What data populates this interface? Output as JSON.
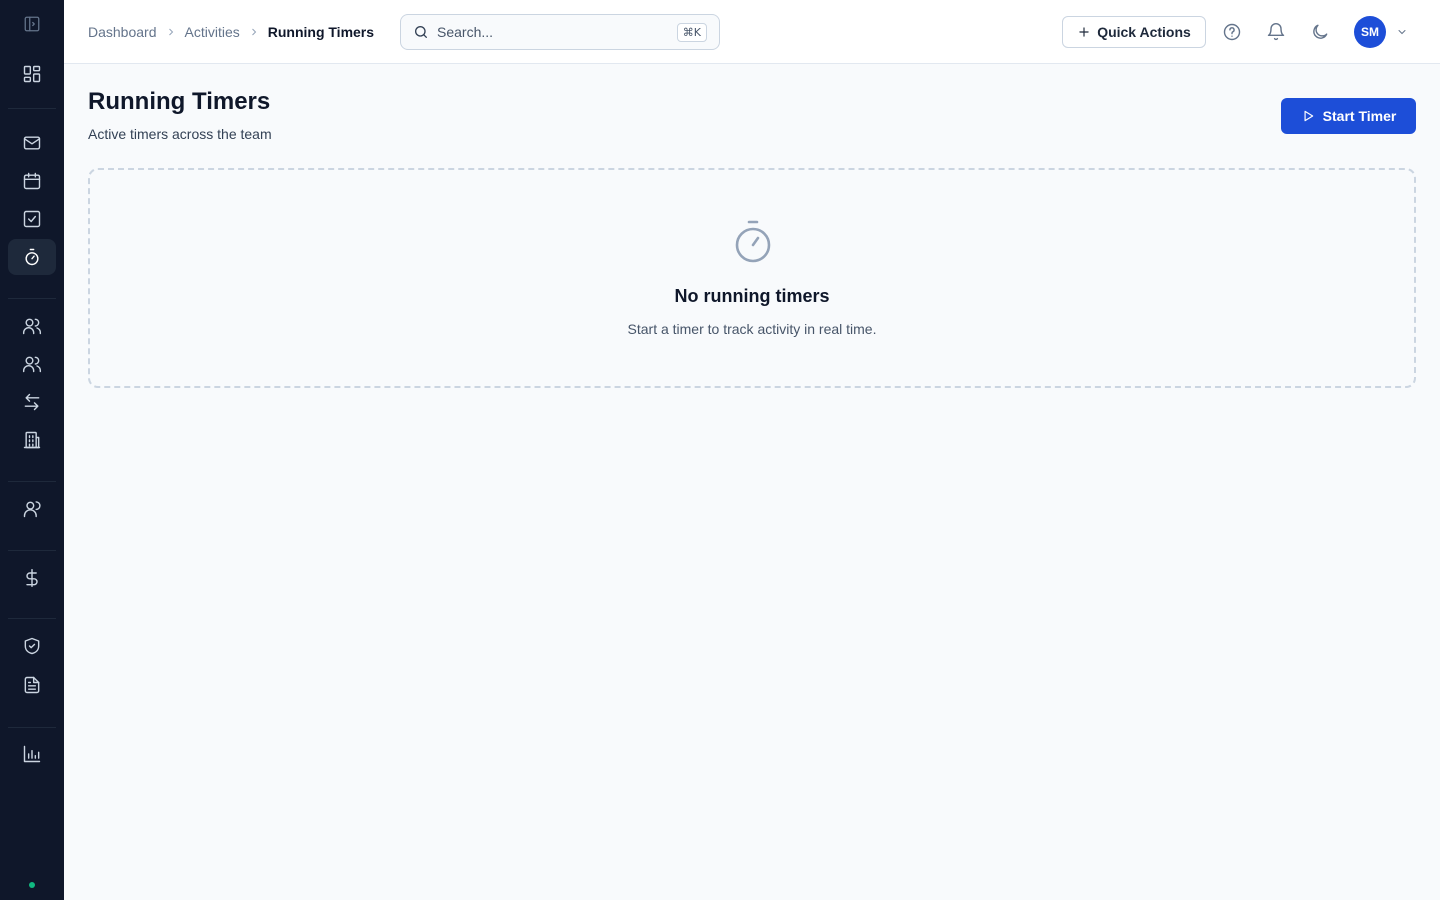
{
  "breadcrumb": {
    "items": [
      "Dashboard",
      "Activities"
    ],
    "current": "Running Timers"
  },
  "search": {
    "placeholder": "Search...",
    "shortcut": "⌘K"
  },
  "header": {
    "quick_actions_label": "Quick Actions",
    "avatar_initials": "SM"
  },
  "sidebar": {
    "active_item": "timers",
    "icons": [
      "panel-toggle-icon",
      "dashboard-grid-icon",
      "mail-icon",
      "calendar-icon",
      "task-check-icon",
      "timer-icon",
      "contacts-icon",
      "team-icon",
      "transfer-icon",
      "company-icon",
      "users-icon",
      "dollar-icon",
      "shield-icon",
      "document-icon",
      "reports-chart-icon"
    ],
    "status": "online",
    "status_color": "#10b981"
  },
  "main": {
    "title": "Running Timers",
    "subtitle": "Active timers across the team",
    "start_button_label": "Start Timer"
  },
  "empty_state": {
    "icon": "stopwatch-icon",
    "title": "No running timers",
    "text": "Start a timer to track activity in real time."
  },
  "colors": {
    "sidebar_bg": "#0f172a",
    "accent": "#1d4ed8",
    "page_bg": "#f8fafc"
  }
}
